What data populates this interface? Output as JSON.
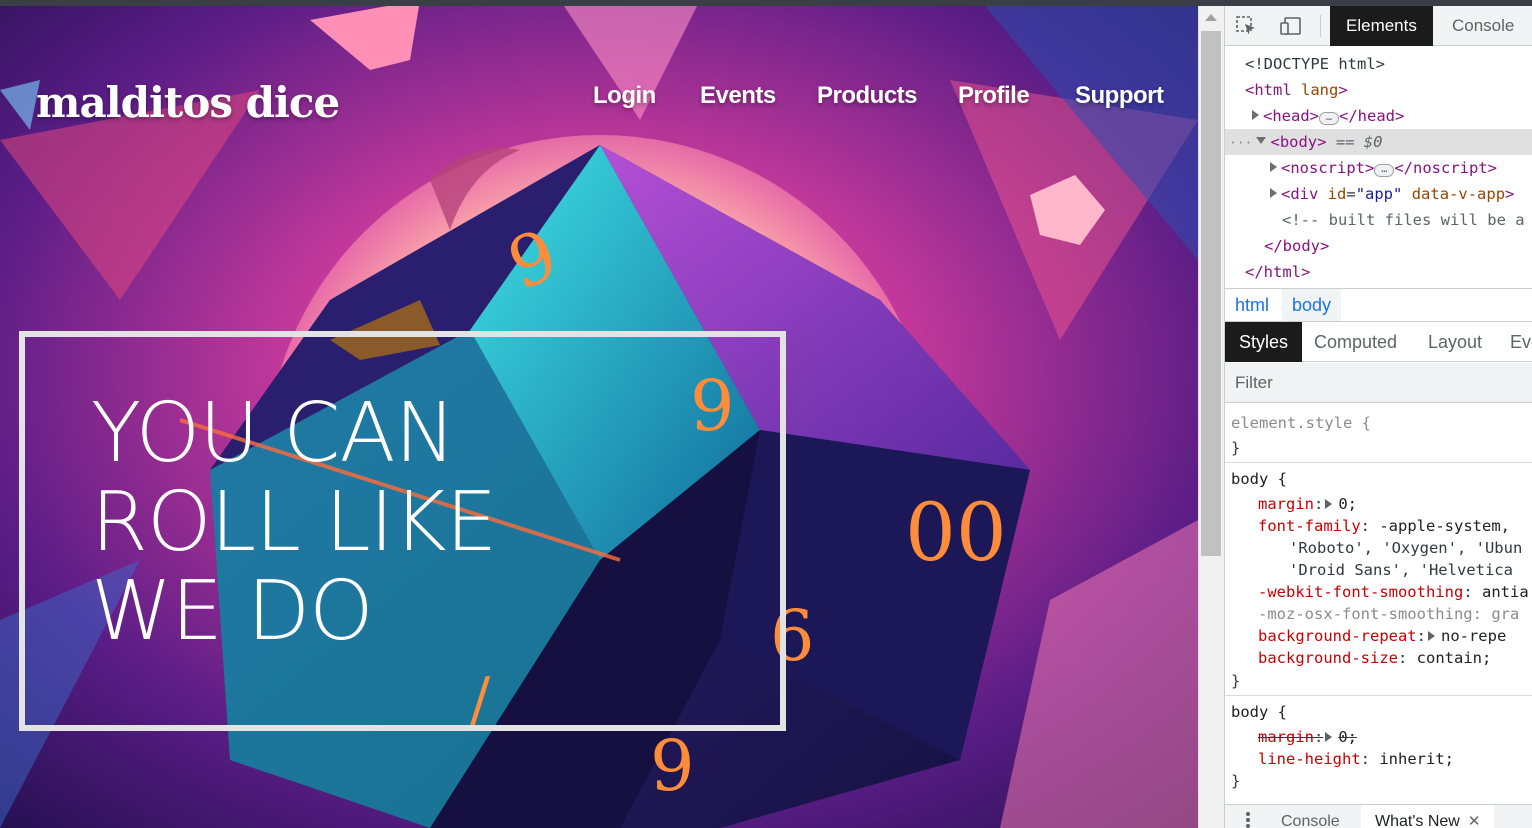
{
  "page": {
    "brand": "malditos dice",
    "nav": [
      "Login",
      "Events",
      "Products",
      "Profile",
      "Support"
    ],
    "hero_lines": [
      "YOU CAN",
      "ROLL LIKE",
      "WE DO"
    ]
  },
  "devtools": {
    "tabs": {
      "elements": "Elements",
      "console": "Console"
    },
    "dom": {
      "doctype": "<!DOCTYPE html>",
      "html_open": "<html",
      "html_attr": "lang",
      "html_close_bracket": ">",
      "head_open": "<head>",
      "head_close": "</head>",
      "body_open": "<body>",
      "body_marker": " == $0",
      "noscript_open": "<noscript>",
      "noscript_close": "</noscript>",
      "div_open": "<div",
      "div_attr_name": "id",
      "div_attr_value": "\"app\"",
      "div_attr_name2": "data-v-app",
      "div_close_bracket": ">",
      "comment": "<!-- built files will be a",
      "body_close": "</body>",
      "html_close": "</html>",
      "ellipsis": "…"
    },
    "breadcrumbs": [
      "html",
      "body"
    ],
    "subtabs": [
      "Styles",
      "Computed",
      "Layout",
      "Eve"
    ],
    "filter_placeholder": "Filter",
    "styles": {
      "element_style": "element.style {",
      "close_brace": "}",
      "rule1_selector": "body {",
      "rule1": [
        {
          "name": "margin",
          "value": "0;"
        },
        {
          "name": "font-family",
          "value": "-apple-system,"
        },
        {
          "cont": "'Roboto', 'Oxygen', 'Ubun"
        },
        {
          "cont": "'Droid Sans', 'Helvetica"
        },
        {
          "name": "-webkit-font-smoothing",
          "value": "antia"
        },
        {
          "name": "-moz-osx-font-smoothing",
          "value": "gra"
        },
        {
          "name": "background-repeat",
          "value": "no-repe"
        },
        {
          "name": "background-size",
          "value": "contain;"
        }
      ],
      "rule2_selector": "body {",
      "rule2": [
        {
          "name": "margin",
          "value": "0;"
        },
        {
          "name": "line-height",
          "value": "inherit;"
        }
      ],
      "colon": ":"
    },
    "drawer": {
      "console": "Console",
      "whats_new": "What's New",
      "close": "✕"
    }
  },
  "colors": {
    "hero_border": "#e3e3e3",
    "devtools_active_tab": "#1b1b1b",
    "tag_purple": "#881280"
  }
}
